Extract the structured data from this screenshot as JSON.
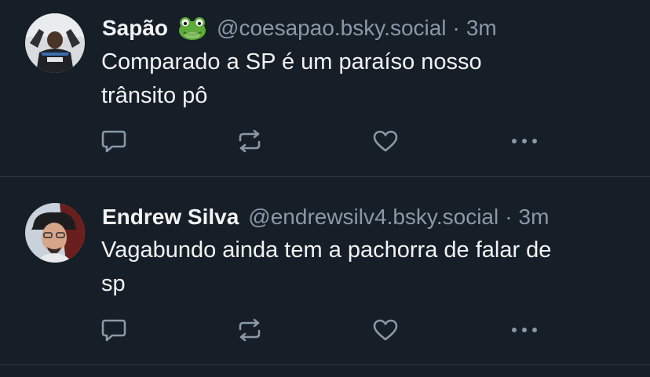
{
  "posts": [
    {
      "display_name": "Sapão",
      "emoji_icon": "frog-emoji-icon",
      "handle": "@coesapao.bsky.social",
      "separator": "·",
      "time": "3m",
      "text": "Comparado a SP é um paraíso nosso\ntrânsito pô"
    },
    {
      "display_name": "Endrew Silva",
      "handle": "@endrewsilv4.bsky.social",
      "separator": "·",
      "time": "3m",
      "text": "Vagabundo ainda tem a pachorra de falar de\nsp"
    }
  ],
  "icons": {
    "reply": "speech-bubble-icon",
    "repost": "repost-arrows-icon",
    "like": "heart-icon",
    "more": "ellipsis-icon"
  },
  "colors": {
    "background": "#161e27",
    "primary_text": "#f1f3f5",
    "secondary_text": "#8b98a5",
    "icon": "#8b98a5",
    "divider": "#2e3a46"
  }
}
